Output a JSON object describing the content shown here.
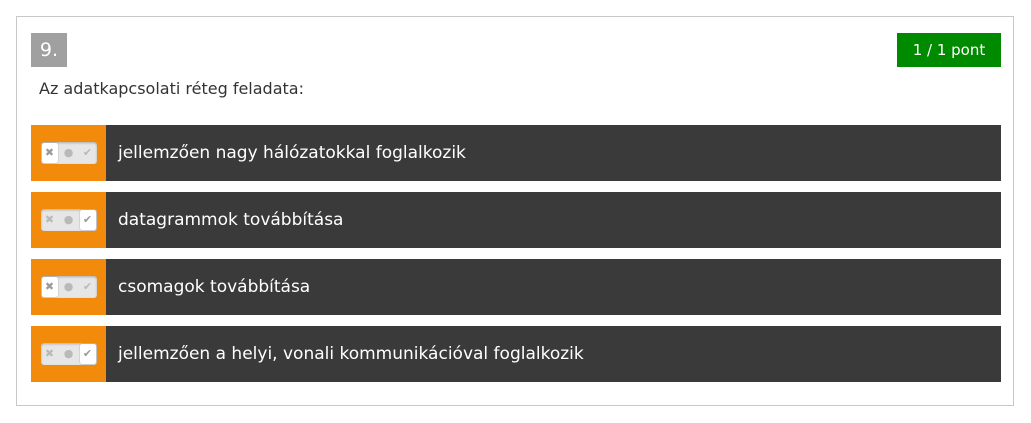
{
  "question": {
    "number": "9.",
    "score": "1 / 1 pont",
    "text": "Az adatkapcsolati réteg feladata:"
  },
  "answers": [
    {
      "label": "jellemzően nagy hálózatokkal foglalkozik",
      "state": "false",
      "icon_false": "✖",
      "icon_neutral": "●",
      "icon_true": "✔"
    },
    {
      "label": "datagrammok továbbítása",
      "state": "true",
      "icon_false": "✖",
      "icon_neutral": "●",
      "icon_true": "✔"
    },
    {
      "label": "csomagok továbbítása",
      "state": "false",
      "icon_false": "✖",
      "icon_neutral": "●",
      "icon_true": "✔"
    },
    {
      "label": "jellemzően a helyi, vonali kommunikációval foglalkozik",
      "state": "true",
      "icon_false": "✖",
      "icon_neutral": "●",
      "icon_true": "✔"
    }
  ],
  "colors": {
    "number_bg": "#a0a0a0",
    "score_bg": "#008a00",
    "answer_bg": "#3a3a3a",
    "toggle_bg": "#f28a0b"
  }
}
